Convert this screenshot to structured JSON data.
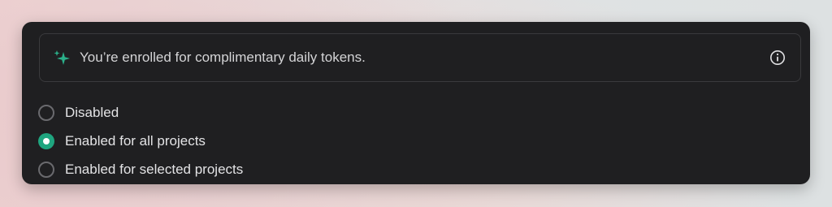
{
  "banner": {
    "icon": "sparkle-icon",
    "text": "You’re enrolled for complimentary daily tokens.",
    "info_icon": "info-icon"
  },
  "options": [
    {
      "label": "Disabled",
      "selected": false
    },
    {
      "label": "Enabled for all projects",
      "selected": true
    },
    {
      "label": "Enabled for selected projects",
      "selected": false
    }
  ],
  "colors": {
    "panel_bg": "#1f1f21",
    "accent": "#1fa57f",
    "sparkle": "#2bb08a",
    "text": "#e3e3e5"
  }
}
